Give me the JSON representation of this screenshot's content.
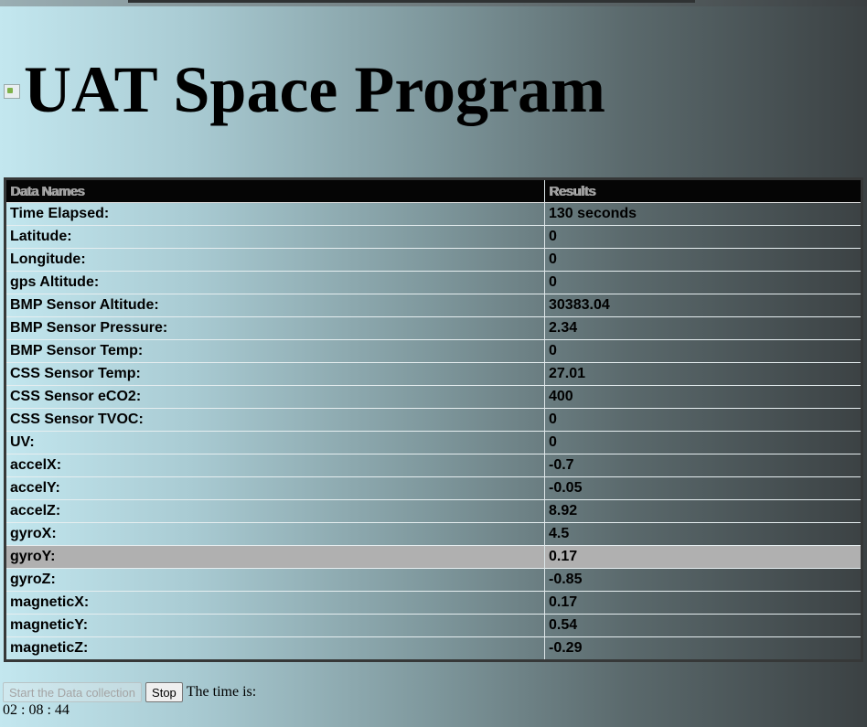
{
  "header": {
    "title": "UAT Space Program",
    "logo_icon": "broken-image-icon"
  },
  "table": {
    "headers": [
      "Data Names",
      "Results"
    ],
    "highlighted_row": 15,
    "rows": [
      {
        "name": "Time Elapsed:",
        "value": "130 seconds"
      },
      {
        "name": "Latitude:",
        "value": "0"
      },
      {
        "name": "Longitude:",
        "value": "0"
      },
      {
        "name": "gps Altitude:",
        "value": "0"
      },
      {
        "name": "BMP Sensor Altitude:",
        "value": "30383.04"
      },
      {
        "name": "BMP Sensor Pressure:",
        "value": "2.34"
      },
      {
        "name": "BMP Sensor Temp:",
        "value": "0"
      },
      {
        "name": "CSS Sensor Temp:",
        "value": "27.01"
      },
      {
        "name": "CSS Sensor eCO2:",
        "value": "400"
      },
      {
        "name": "CSS Sensor TVOC:",
        "value": "0"
      },
      {
        "name": "UV:",
        "value": "0"
      },
      {
        "name": "accelX:",
        "value": "-0.7"
      },
      {
        "name": "accelY:",
        "value": "-0.05"
      },
      {
        "name": "accelZ:",
        "value": "8.92"
      },
      {
        "name": "gyroX:",
        "value": "4.5"
      },
      {
        "name": "gyroY:",
        "value": "0.17"
      },
      {
        "name": "gyroZ:",
        "value": "-0.85"
      },
      {
        "name": "magneticX:",
        "value": "0.17"
      },
      {
        "name": "magneticY:",
        "value": "0.54"
      },
      {
        "name": "magneticZ:",
        "value": "-0.29"
      }
    ]
  },
  "controls": {
    "start_label": "Start the Data collection",
    "stop_label": "Stop",
    "time_label": "The time is:",
    "clock": "02 : 08 : 44"
  },
  "colors": {
    "header_bg": "#050505",
    "highlight_row": "#b0b0b0",
    "gradient_start": "#c3e7ef",
    "gradient_end": "#3b4143"
  }
}
